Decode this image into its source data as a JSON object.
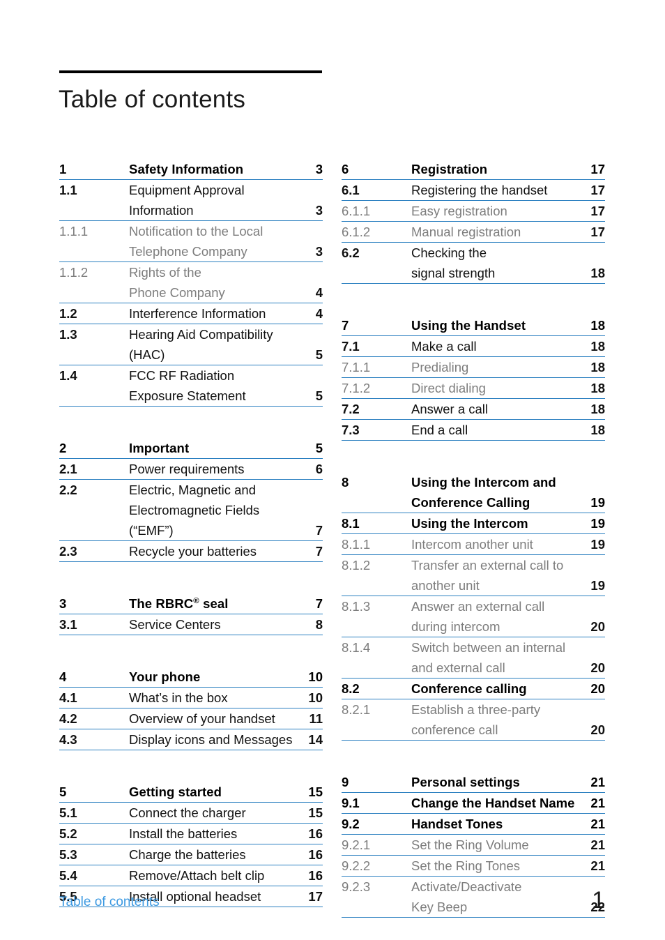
{
  "document": {
    "title": "Table of contents",
    "footer_label": "Table of contents",
    "footer_page_number": "1",
    "rule_color": "#2a7fc0",
    "accent_color": "#3d9ae2",
    "level3_text_color": "#7d7d7d"
  },
  "columns": [
    {
      "side": "left",
      "groups": [
        {
          "entries": [
            {
              "number": "1",
              "label": "Safety Information",
              "page": "3",
              "level": 1,
              "lines": [
                "Safety Information"
              ]
            },
            {
              "number": "1.1",
              "label": "Equipment Approval Information",
              "page": "3",
              "level": 2,
              "lines": [
                "Equipment Approval",
                "Information"
              ]
            },
            {
              "number": "1.1.1",
              "label": "Notification to the Local Telephone Company",
              "page": "3",
              "level": 3,
              "lines": [
                "Notification to the Local",
                "Telephone Company"
              ]
            },
            {
              "number": "1.1.2",
              "label": "Rights of the Phone Company",
              "page": "4",
              "level": 3,
              "lines": [
                "Rights of the",
                "Phone Company"
              ]
            },
            {
              "number": "1.2",
              "label": "Interference Information",
              "page": "4",
              "level": 2,
              "lines": [
                "Interference Information"
              ]
            },
            {
              "number": "1.3",
              "label": "Hearing Aid Compatibility (HAC)",
              "page": "5",
              "level": 2,
              "lines": [
                "Hearing Aid Compatibility",
                "(HAC)"
              ]
            },
            {
              "number": "1.4",
              "label": "FCC RF Radiation Exposure Statement",
              "page": "5",
              "level": 2,
              "lines": [
                "FCC RF Radiation",
                "Exposure Statement"
              ]
            }
          ]
        },
        {
          "entries": [
            {
              "number": "2",
              "label": "Important",
              "page": "5",
              "level": 1,
              "lines": [
                "Important"
              ]
            },
            {
              "number": "2.1",
              "label": "Power requirements",
              "page": "6",
              "level": 2,
              "lines": [
                "Power requirements"
              ]
            },
            {
              "number": "2.2",
              "label": "Electric, Magnetic and Electromagnetic Fields (“EMF”)",
              "page": "7",
              "level": 2,
              "lines": [
                "Electric, Magnetic and",
                "Electromagnetic Fields",
                "(“EMF”)"
              ]
            },
            {
              "number": "2.3",
              "label": "Recycle your batteries",
              "page": "7",
              "level": 2,
              "lines": [
                "Recycle your batteries"
              ]
            }
          ]
        },
        {
          "entries": [
            {
              "number": "3",
              "label": "The RBRC® seal",
              "page": "7",
              "level": 1,
              "lines": [
                "The RBRC<sup>®</sup> seal"
              ],
              "html": true
            },
            {
              "number": "3.1",
              "label": "Service Centers",
              "page": "8",
              "level": 2,
              "lines": [
                "Service Centers"
              ]
            }
          ]
        },
        {
          "entries": [
            {
              "number": "4",
              "label": "Your phone",
              "page": "10",
              "level": 1,
              "lines": [
                "Your phone"
              ]
            },
            {
              "number": "4.1",
              "label": "What’s in the box",
              "page": "10",
              "level": 2,
              "lines": [
                "What’s in the box"
              ]
            },
            {
              "number": "4.2",
              "label": "Overview of your handset",
              "page": "11",
              "level": 2,
              "lines": [
                "Overview of your handset"
              ]
            },
            {
              "number": "4.3",
              "label": "Display icons and Messages",
              "page": "14",
              "level": 2,
              "lines": [
                "Display icons and Messages"
              ]
            }
          ]
        },
        {
          "entries": [
            {
              "number": "5",
              "label": "Getting started",
              "page": "15",
              "level": 1,
              "lines": [
                "Getting started"
              ]
            },
            {
              "number": "5.1",
              "label": "Connect the charger",
              "page": "15",
              "level": 2,
              "lines": [
                "Connect the charger"
              ]
            },
            {
              "number": "5.2",
              "label": "Install the batteries",
              "page": "16",
              "level": 2,
              "lines": [
                "Install the batteries"
              ]
            },
            {
              "number": "5.3",
              "label": "Charge the batteries",
              "page": "16",
              "level": 2,
              "lines": [
                "Charge the batteries"
              ]
            },
            {
              "number": "5.4",
              "label": "Remove/Attach belt clip",
              "page": "16",
              "level": 2,
              "lines": [
                "Remove/Attach belt clip"
              ]
            },
            {
              "number": "5.5",
              "label": "Install optional headset",
              "page": "17",
              "level": 2,
              "lines": [
                "Install optional headset"
              ]
            }
          ]
        }
      ]
    },
    {
      "side": "right",
      "groups": [
        {
          "entries": [
            {
              "number": "6",
              "label": "Registration",
              "page": "17",
              "level": 1,
              "lines": [
                "Registration"
              ]
            },
            {
              "number": "6.1",
              "label": "Registering the handset",
              "page": "17",
              "level": 2,
              "lines": [
                "Registering the handset"
              ]
            },
            {
              "number": "6.1.1",
              "label": "Easy registration",
              "page": "17",
              "level": 3,
              "lines": [
                "Easy registration"
              ]
            },
            {
              "number": "6.1.2",
              "label": "Manual registration",
              "page": "17",
              "level": 3,
              "lines": [
                "Manual registration"
              ]
            },
            {
              "number": "6.2",
              "label": "Checking the signal strength",
              "page": "18",
              "level": 2,
              "lines": [
                "Checking the",
                "signal strength"
              ]
            }
          ]
        },
        {
          "entries": [
            {
              "number": "7",
              "label": "Using the Handset",
              "page": "18",
              "level": 1,
              "lines": [
                "Using the Handset"
              ]
            },
            {
              "number": "7.1",
              "label": "Make a call",
              "page": "18",
              "level": 2,
              "lines": [
                "Make a call"
              ]
            },
            {
              "number": "7.1.1",
              "label": "Predialing",
              "page": "18",
              "level": 3,
              "lines": [
                "Predialing"
              ]
            },
            {
              "number": "7.1.2",
              "label": "Direct dialing",
              "page": "18",
              "level": 3,
              "lines": [
                "Direct dialing"
              ]
            },
            {
              "number": "7.2",
              "label": "Answer a call",
              "page": "18",
              "level": 2,
              "lines": [
                "Answer a call"
              ]
            },
            {
              "number": "7.3",
              "label": "End a call",
              "page": "18",
              "level": 2,
              "lines": [
                "End a call"
              ]
            }
          ]
        },
        {
          "entries": [
            {
              "number": "8",
              "label": "Using the Intercom and Conference Calling",
              "page": "19",
              "level": 1,
              "lines": [
                "Using the Intercom and",
                "Conference Calling"
              ]
            },
            {
              "number": "8.1",
              "label": "Using the Intercom",
              "page": "19",
              "level": 22,
              "lines": [
                "Using the Intercom"
              ]
            },
            {
              "number": "8.1.1",
              "label": "Intercom another unit",
              "page": "19",
              "level": 3,
              "lines": [
                "Intercom another unit"
              ]
            },
            {
              "number": "8.1.2",
              "label": "Transfer an external call to another unit",
              "page": "19",
              "level": 3,
              "lines": [
                "Transfer an external call to",
                "another unit"
              ]
            },
            {
              "number": "8.1.3",
              "label": "Answer an external call during intercom",
              "page": "20",
              "level": 3,
              "lines": [
                "Answer an external call",
                "during intercom"
              ]
            },
            {
              "number": "8.1.4",
              "label": "Switch between an internal and external call",
              "page": "20",
              "level": 3,
              "lines": [
                "Switch between an internal",
                "and external call"
              ]
            },
            {
              "number": "8.2",
              "label": "Conference calling",
              "page": "20",
              "level": 22,
              "lines": [
                "Conference calling"
              ]
            },
            {
              "number": "8.2.1",
              "label": "Establish a three-party conference call",
              "page": "20",
              "level": 3,
              "lines": [
                "Establish a three-party",
                "conference call"
              ]
            }
          ]
        },
        {
          "entries": [
            {
              "number": "9",
              "label": "Personal settings",
              "page": "21",
              "level": 1,
              "lines": [
                "Personal settings"
              ]
            },
            {
              "number": "9.1",
              "label": "Change the Handset Name",
              "page": "21",
              "level": 22,
              "lines": [
                "Change the Handset Name"
              ]
            },
            {
              "number": "9.2",
              "label": "Handset Tones",
              "page": "21",
              "level": 22,
              "lines": [
                "Handset Tones"
              ]
            },
            {
              "number": "9.2.1",
              "label": "Set the Ring Volume",
              "page": "21",
              "level": 3,
              "lines": [
                "Set the Ring Volume"
              ]
            },
            {
              "number": "9.2.2",
              "label": "Set the Ring Tones",
              "page": "21",
              "level": 3,
              "lines": [
                "Set the Ring Tones"
              ]
            },
            {
              "number": "9.2.3",
              "label": "Activate/Deactivate Key Beep",
              "page": "22",
              "level": 3,
              "lines": [
                "Activate/Deactivate",
                "Key Beep"
              ]
            }
          ]
        }
      ]
    }
  ]
}
